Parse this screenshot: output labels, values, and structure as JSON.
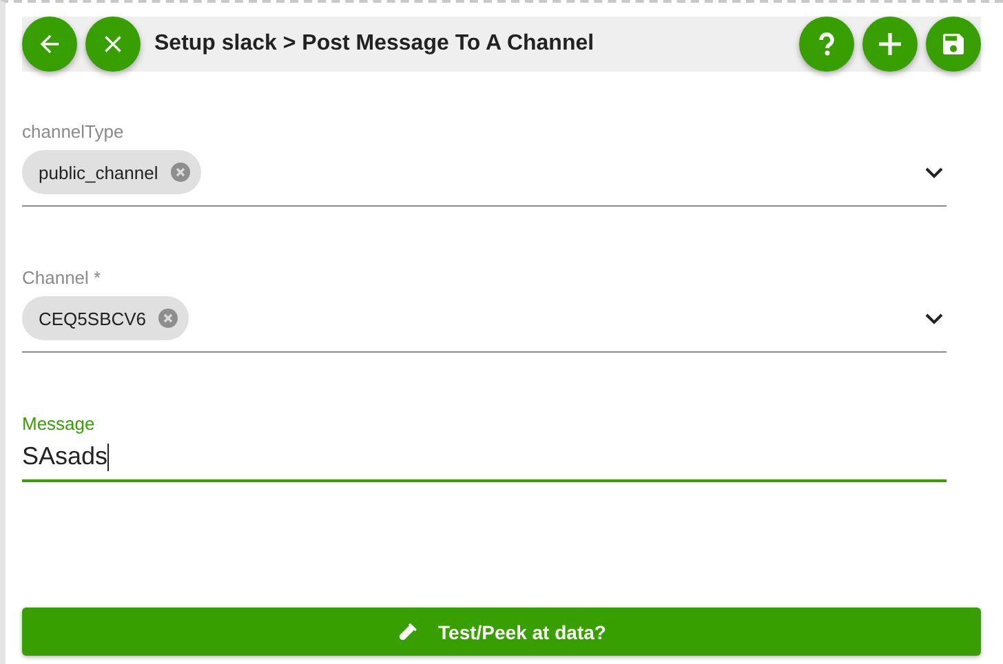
{
  "header": {
    "title": "Setup slack > Post Message To A Channel"
  },
  "fields": [
    {
      "kind": "select",
      "label": "channelType",
      "chip": "public_channel",
      "focused": false
    },
    {
      "kind": "select",
      "label": "Channel *",
      "chip": "CEQ5SBCV6",
      "focused": false
    },
    {
      "kind": "text",
      "label": "Message",
      "value": "SAsads",
      "focused": true
    }
  ],
  "action_button": {
    "label": "Test/Peek at data?"
  }
}
